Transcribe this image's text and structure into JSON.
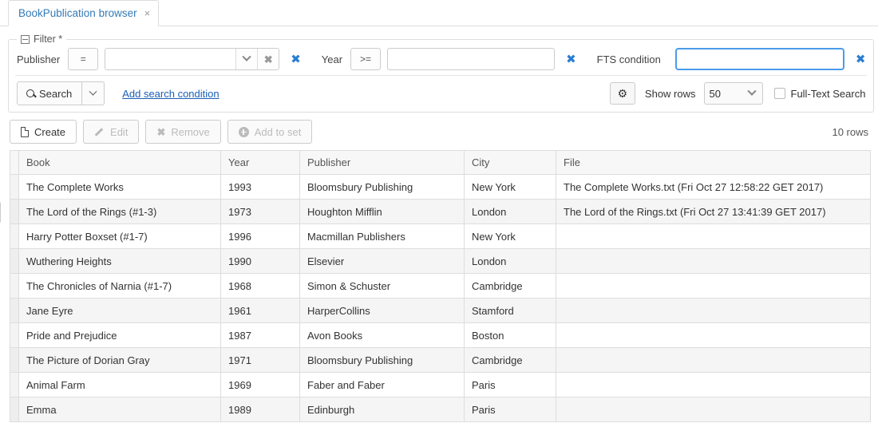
{
  "tab": {
    "label": "BookPublication browser",
    "close": "×"
  },
  "filter": {
    "legend": "Filter *",
    "conditions": [
      {
        "label": "Publisher",
        "operator": "=",
        "value": "",
        "control": "combobox",
        "focused": false
      },
      {
        "label": "Year",
        "operator": ">=",
        "value": "",
        "control": "text",
        "focused": false
      },
      {
        "label": "FTS condition",
        "operator": "",
        "value": "",
        "control": "text",
        "focused": true
      }
    ],
    "search_button": "Search",
    "add_condition_link": "Add search condition",
    "gear_icon": "gear-icon",
    "show_rows_label": "Show rows",
    "show_rows_value": "50",
    "show_rows_options": [
      "50"
    ],
    "full_text_search_label": "Full-Text Search",
    "full_text_search_checked": false
  },
  "toolbar": {
    "buttons": [
      {
        "label": "Create",
        "icon": "page-icon",
        "disabled": false
      },
      {
        "label": "Edit",
        "icon": "pencil-icon",
        "disabled": true
      },
      {
        "label": "Remove",
        "icon": "x-icon",
        "disabled": true
      },
      {
        "label": "Add to set",
        "icon": "plus-icon",
        "disabled": true
      }
    ],
    "row_count": "10 rows"
  },
  "table": {
    "columns": [
      "Book",
      "Year",
      "Publisher",
      "City",
      "File"
    ],
    "rows": [
      {
        "book": "The Complete Works",
        "year": "1993",
        "publisher": "Bloomsbury Publishing",
        "city": "New York",
        "file": "The Complete Works.txt (Fri Oct 27 12:58:22 GET 2017)"
      },
      {
        "book": "The Lord of the Rings (#1-3)",
        "year": "1973",
        "publisher": "Houghton Mifflin",
        "city": "London",
        "file": "The Lord of the Rings.txt (Fri Oct 27 13:41:39 GET 2017)"
      },
      {
        "book": "Harry Potter Boxset (#1-7)",
        "year": "1996",
        "publisher": "Macmillan Publishers",
        "city": "New York",
        "file": ""
      },
      {
        "book": "Wuthering Heights",
        "year": "1990",
        "publisher": "Elsevier",
        "city": "London",
        "file": ""
      },
      {
        "book": "The Chronicles of Narnia (#1-7)",
        "year": "1968",
        "publisher": "Simon & Schuster",
        "city": "Cambridge",
        "file": ""
      },
      {
        "book": "Jane Eyre",
        "year": "1961",
        "publisher": "HarperCollins",
        "city": "Stamford",
        "file": ""
      },
      {
        "book": "Pride and Prejudice",
        "year": "1987",
        "publisher": "Avon Books",
        "city": "Boston",
        "file": ""
      },
      {
        "book": "The Picture of Dorian Gray",
        "year": "1971",
        "publisher": "Bloomsbury Publishing",
        "city": "Cambridge",
        "file": ""
      },
      {
        "book": "Animal Farm",
        "year": "1969",
        "publisher": "Faber and Faber",
        "city": "Paris",
        "file": ""
      },
      {
        "book": "Emma",
        "year": "1989",
        "publisher": "Edinburgh",
        "city": "Paris",
        "file": ""
      }
    ]
  },
  "colors": {
    "accent": "#337ab7",
    "link": "#1a5fb4",
    "remove_x": "#2b7dd1",
    "focus_border": "#4a9bea",
    "row_alt": "#f5f5f5",
    "header_bg": "#f7f7f7",
    "border": "#dddddd"
  }
}
